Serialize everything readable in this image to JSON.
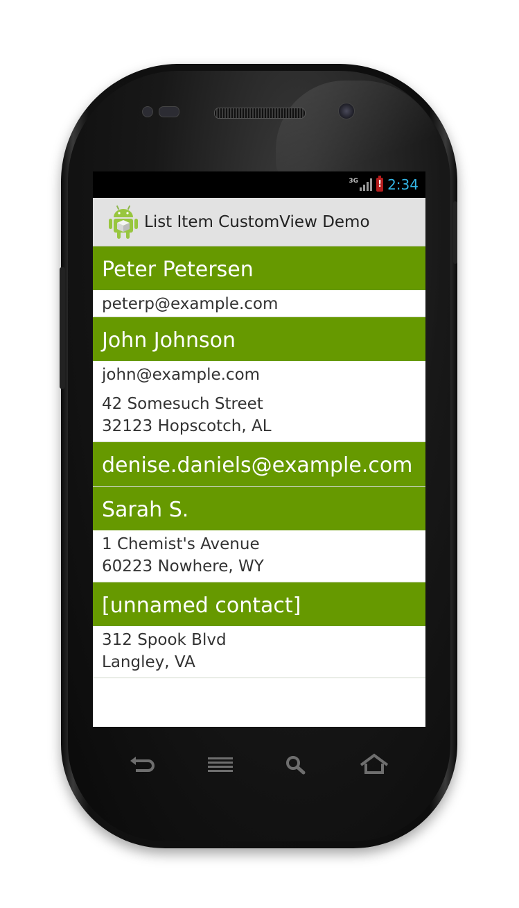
{
  "status_bar": {
    "network": "3G",
    "battery_alert": "!",
    "time": "2:34"
  },
  "action_bar": {
    "title": "List Item CustomView Demo",
    "icon": "android-app-icon"
  },
  "contacts": [
    {
      "name": "Peter Petersen",
      "email": "peterp@example.com",
      "address": []
    },
    {
      "name": "John Johnson",
      "email": "john@example.com",
      "address": [
        "42 Somesuch Street",
        "32123 Hopscotch, AL"
      ]
    },
    {
      "name": "denise.daniels@example.com",
      "email": "",
      "address": []
    },
    {
      "name": "Sarah S.",
      "email": "",
      "address": [
        "1 Chemist's Avenue",
        "60223 Nowhere, WY"
      ]
    },
    {
      "name": "[unnamed contact]",
      "email": "",
      "address": [
        "312 Spook Blvd",
        "Langley, VA"
      ]
    }
  ],
  "nav_buttons": [
    "back-icon",
    "menu-icon",
    "search-icon",
    "home-icon"
  ],
  "colors": {
    "header_green": "#669900",
    "clock_blue": "#33b5e5",
    "action_bar": "#e2e2e2"
  }
}
